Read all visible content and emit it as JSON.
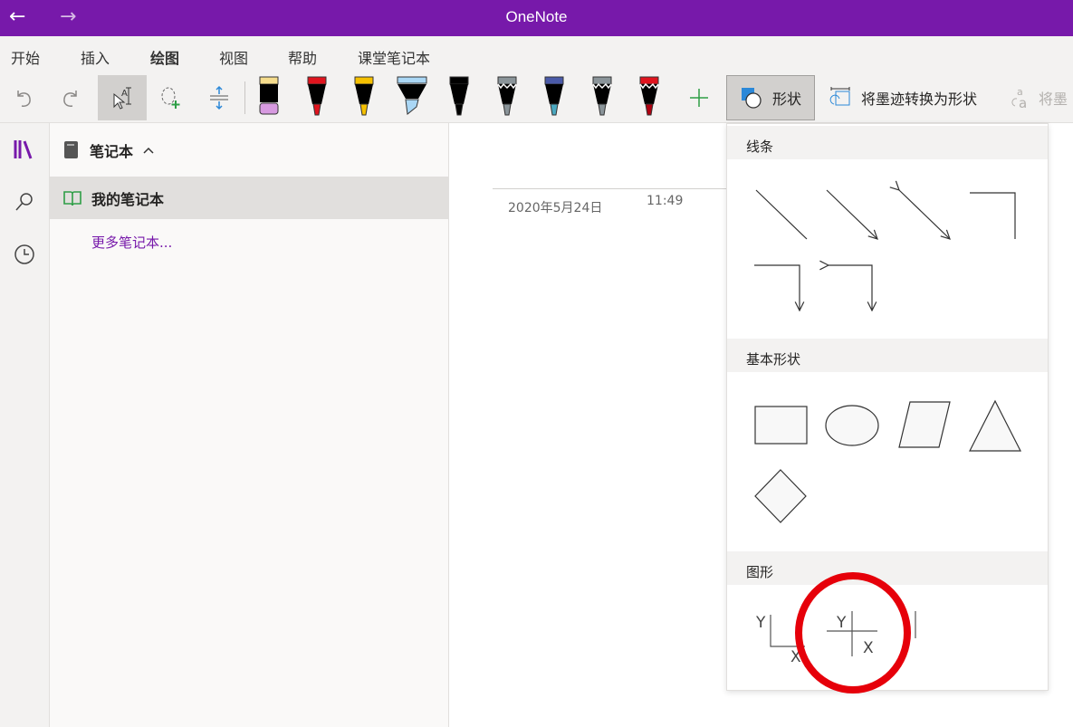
{
  "titlebar": {
    "title": "OneNote",
    "back_icon": "←",
    "forward_icon": "→"
  },
  "menu": {
    "tabs": [
      {
        "label": "开始"
      },
      {
        "label": "插入"
      },
      {
        "label": "绘图"
      },
      {
        "label": "视图"
      },
      {
        "label": "帮助"
      },
      {
        "label": "课堂笔记本"
      }
    ]
  },
  "toolbar": {
    "shapes_label": "形状",
    "convert_label": "将墨迹转换为形状",
    "convert_math_label": "将墨",
    "pens": [
      {
        "name": "eraser",
        "tip": "#d79ae0",
        "cap": "#f5dc8c"
      },
      {
        "name": "red-pen",
        "tip": "#e0141e",
        "cap": "#e0141e"
      },
      {
        "name": "yellow-pen",
        "tip": "#f5c000",
        "cap": "#f5c000"
      },
      {
        "name": "highlighter",
        "tip": "#aad7f5",
        "cap": "#aad7f5"
      },
      {
        "name": "black-pen",
        "tip": "#000000",
        "cap": "#000000"
      },
      {
        "name": "gray-pencil",
        "tip": "#8a9499",
        "cap": "#8a9499"
      },
      {
        "name": "galaxy-pen",
        "tip": "#4aa8c0",
        "cap": "#4a5aa8"
      },
      {
        "name": "gray-pencil-2",
        "tip": "#8a9499",
        "cap": "#8a9499"
      },
      {
        "name": "red-pencil",
        "tip": "#b00010",
        "cap": "#e0141e"
      }
    ]
  },
  "sidebar": {
    "notebooks_label": "笔记本",
    "current_notebook": "我的笔记本",
    "more_notebooks": "更多笔记本..."
  },
  "page": {
    "date": "2020年5月24日",
    "time": "11:49"
  },
  "shapes_menu": {
    "sections": [
      {
        "label": "线条"
      },
      {
        "label": "基本形状"
      },
      {
        "label": "图形"
      }
    ],
    "axis_labels": {
      "x": "X",
      "y": "Y"
    }
  }
}
